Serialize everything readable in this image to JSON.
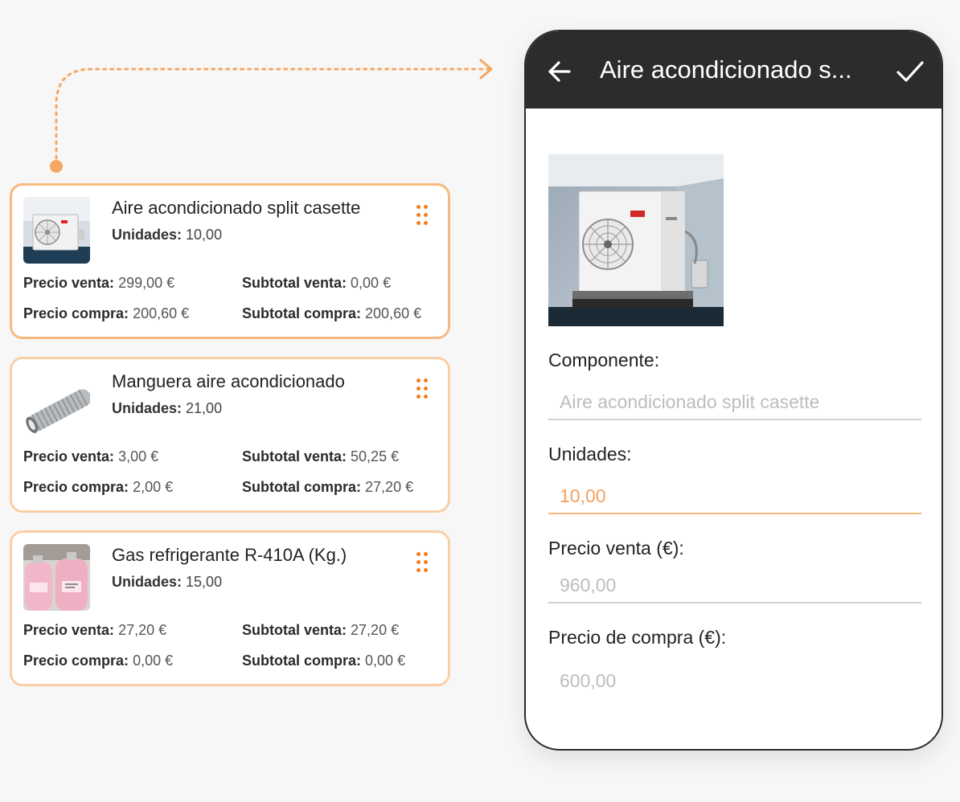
{
  "colors": {
    "accent": "#f47e1c",
    "card_border": "#f9cfa6",
    "card_border_active": "#f7b97d",
    "appbar_bg": "#2c2c2c",
    "focused_input": "#f4a060",
    "placeholder_text": "#bdbdbd"
  },
  "cards": [
    {
      "title": "Aire acondicionado split casette",
      "units_label": "Unidades:",
      "units_value": "10,00",
      "precio_venta_label": "Precio venta:",
      "precio_venta_value": "299,00 €",
      "subtotal_venta_label": "Subtotal venta:",
      "subtotal_venta_value": "0,00 €",
      "precio_compra_label": "Precio compra:",
      "precio_compra_value": "200,60 €",
      "subtotal_compra_label": "Subtotal compra:",
      "subtotal_compra_value": "200,60 €",
      "thumb_icon": "air-conditioner-unit-photo"
    },
    {
      "title": "Manguera aire acondicionado",
      "units_label": "Unidades:",
      "units_value": "21,00",
      "precio_venta_label": "Precio venta:",
      "precio_venta_value": "3,00 €",
      "subtotal_venta_label": "Subtotal venta:",
      "subtotal_venta_value": "50,25 €",
      "precio_compra_label": "Precio compra:",
      "precio_compra_value": "2,00 €",
      "subtotal_compra_label": "Subtotal compra:",
      "subtotal_compra_value": "27,20 €",
      "thumb_icon": "hose-photo"
    },
    {
      "title": "Gas refrigerante R-410A (Kg.)",
      "units_label": "Unidades:",
      "units_value": "15,00",
      "precio_venta_label": "Precio venta:",
      "precio_venta_value": "27,20 €",
      "subtotal_venta_label": "Subtotal venta:",
      "subtotal_venta_value": "27,20 €",
      "precio_compra_label": "Precio compra:",
      "precio_compra_value": "0,00 €",
      "subtotal_compra_label": "Subtotal compra:",
      "subtotal_compra_value": "0,00 €",
      "thumb_icon": "gas-cylinders-photo"
    }
  ],
  "detail": {
    "title": "Aire acondicionado s...",
    "back_icon": "arrow-left-icon",
    "confirm_icon": "check-icon",
    "componente_label": "Componente:",
    "componente_value": "Aire acondicionado split casette",
    "unidades_label": "Unidades:",
    "unidades_value": "10,00",
    "precio_venta_label": "Precio venta (€):",
    "precio_venta_value": "960,00",
    "precio_compra_label": "Precio de compra (€):",
    "precio_compra_value": "600,00"
  }
}
